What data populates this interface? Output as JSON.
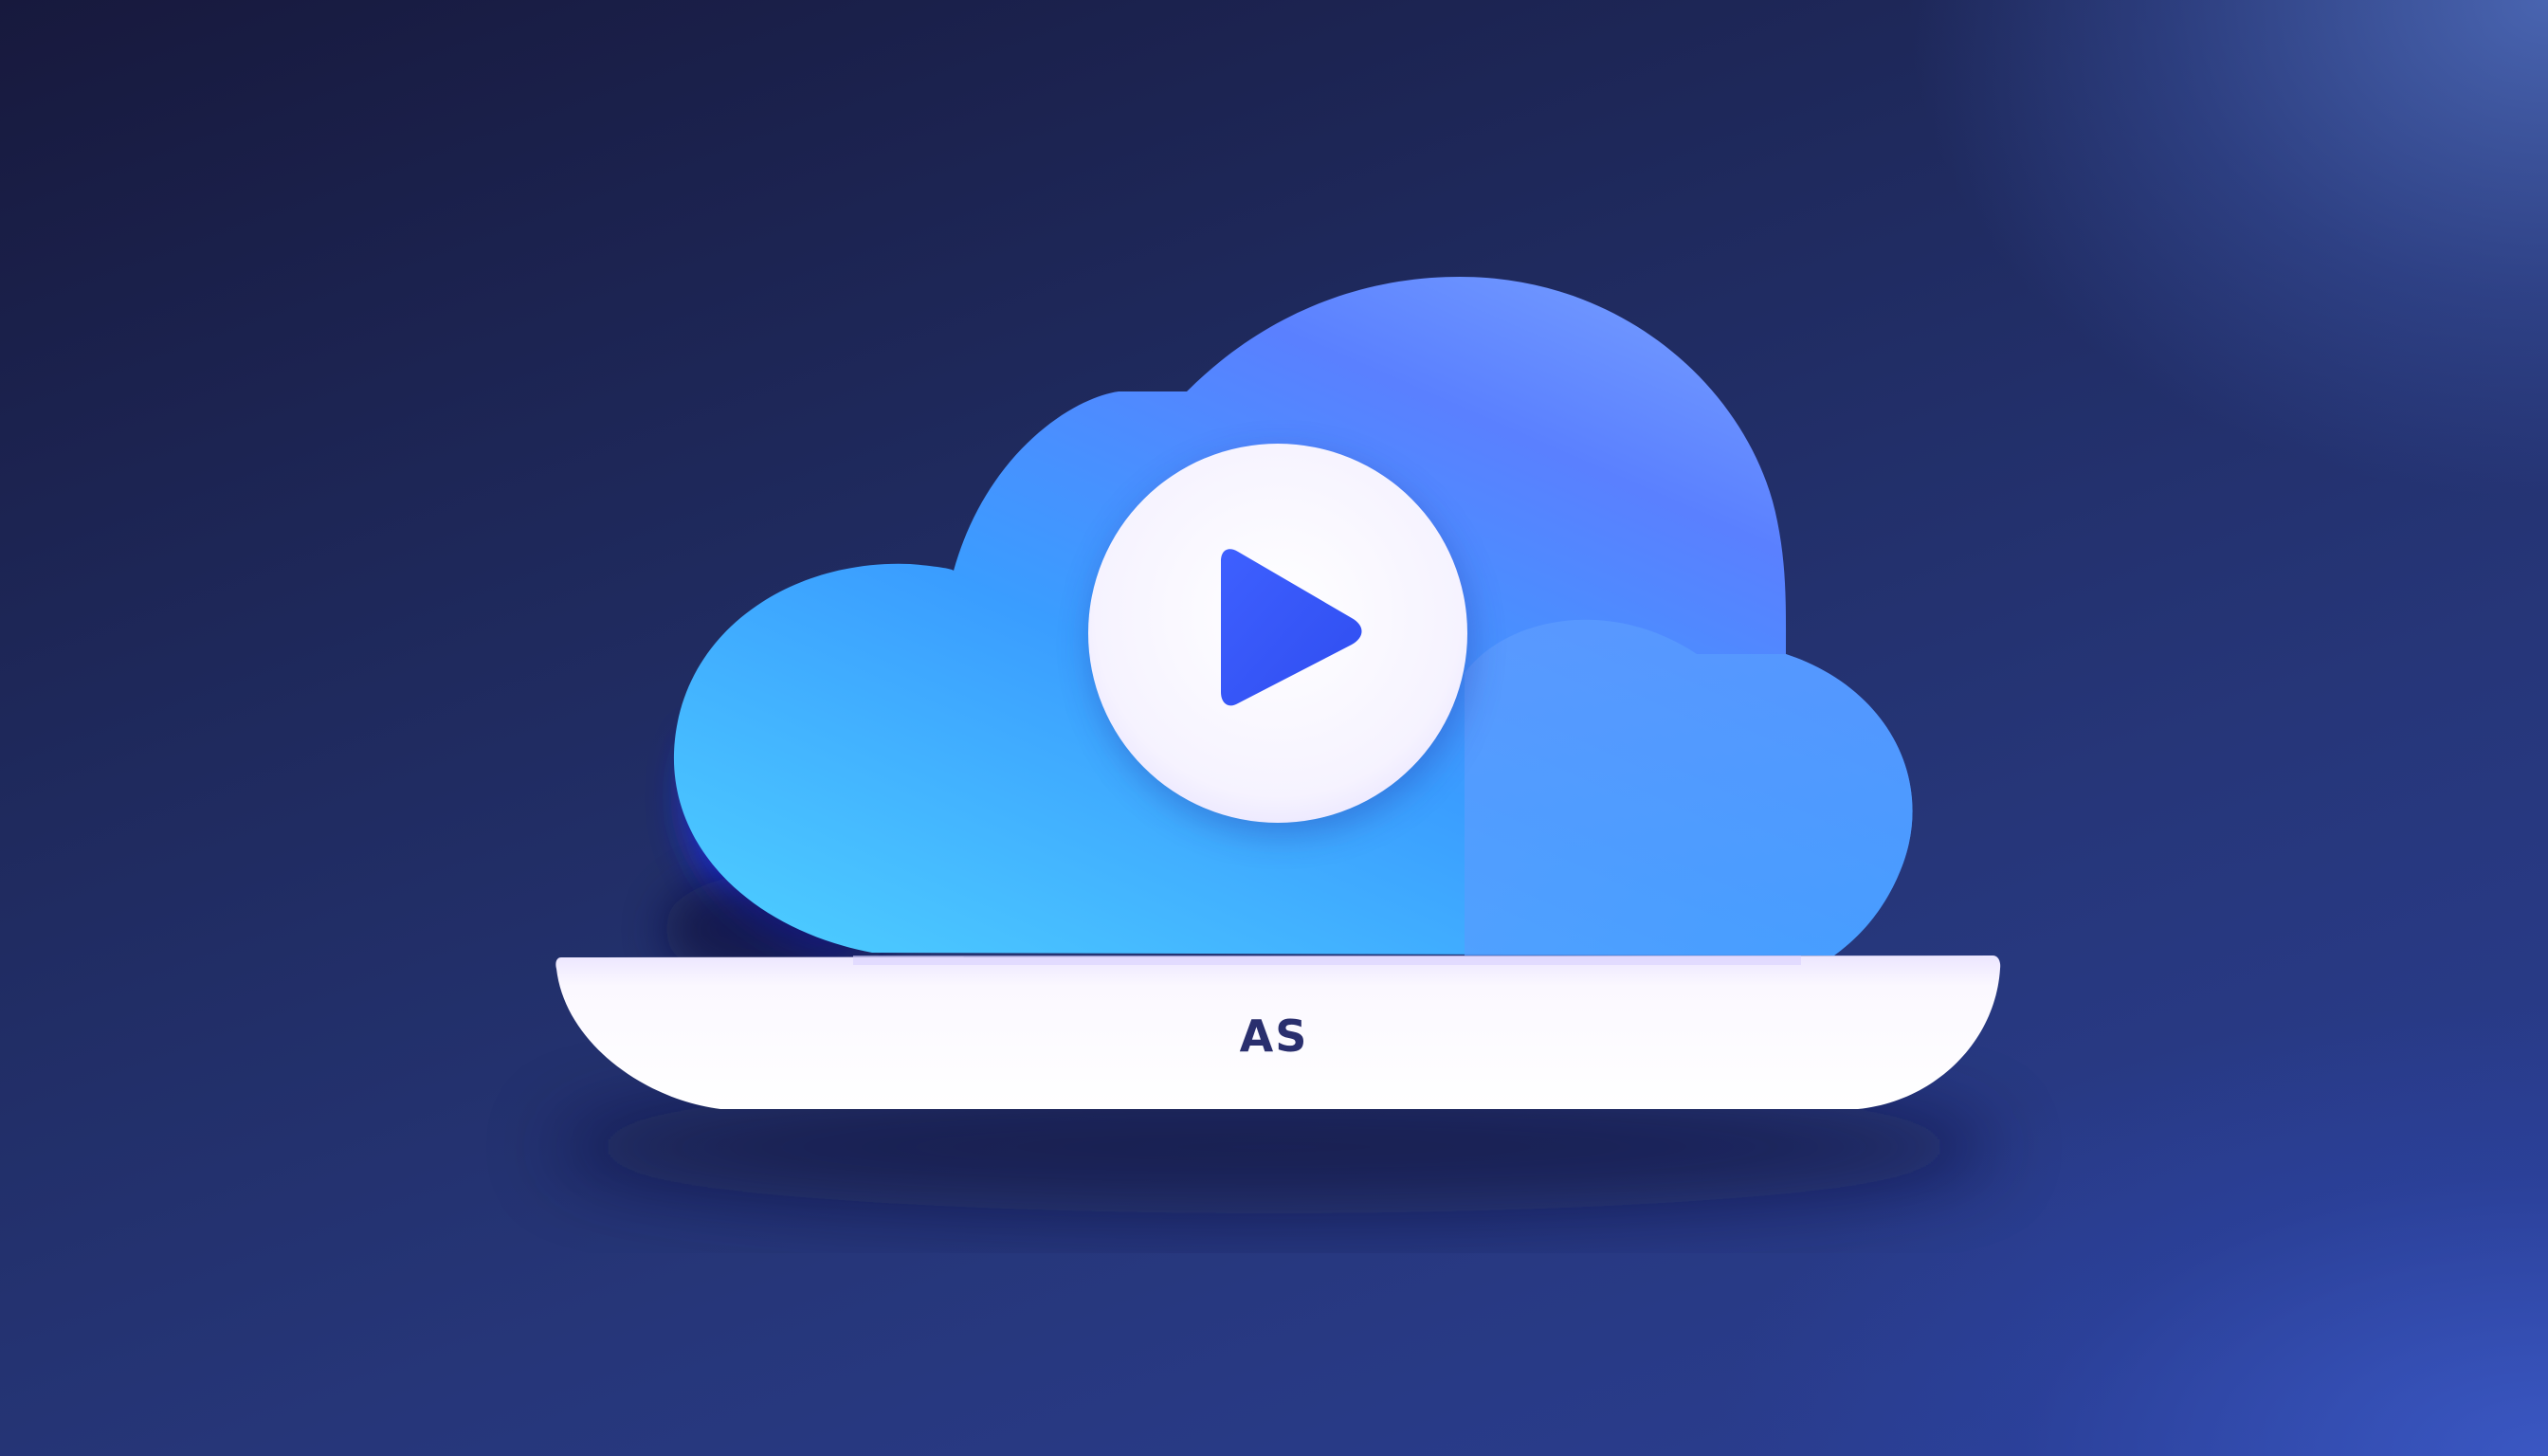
{
  "base": {
    "label": "AS"
  },
  "icons": {
    "cloud": "cloud-icon",
    "play": "play-icon"
  },
  "colors": {
    "background_dark": "#17193d",
    "background_light": "#3f5aa8",
    "cloud_light": "#4cc6ff",
    "cloud_mid": "#3f9cff",
    "cloud_deep": "#5b7cff",
    "play_badge": "#ffffff",
    "play_triangle": "#3a5cff",
    "base_fill": "#fbf8ff",
    "label_color": "#2a2f6e"
  }
}
